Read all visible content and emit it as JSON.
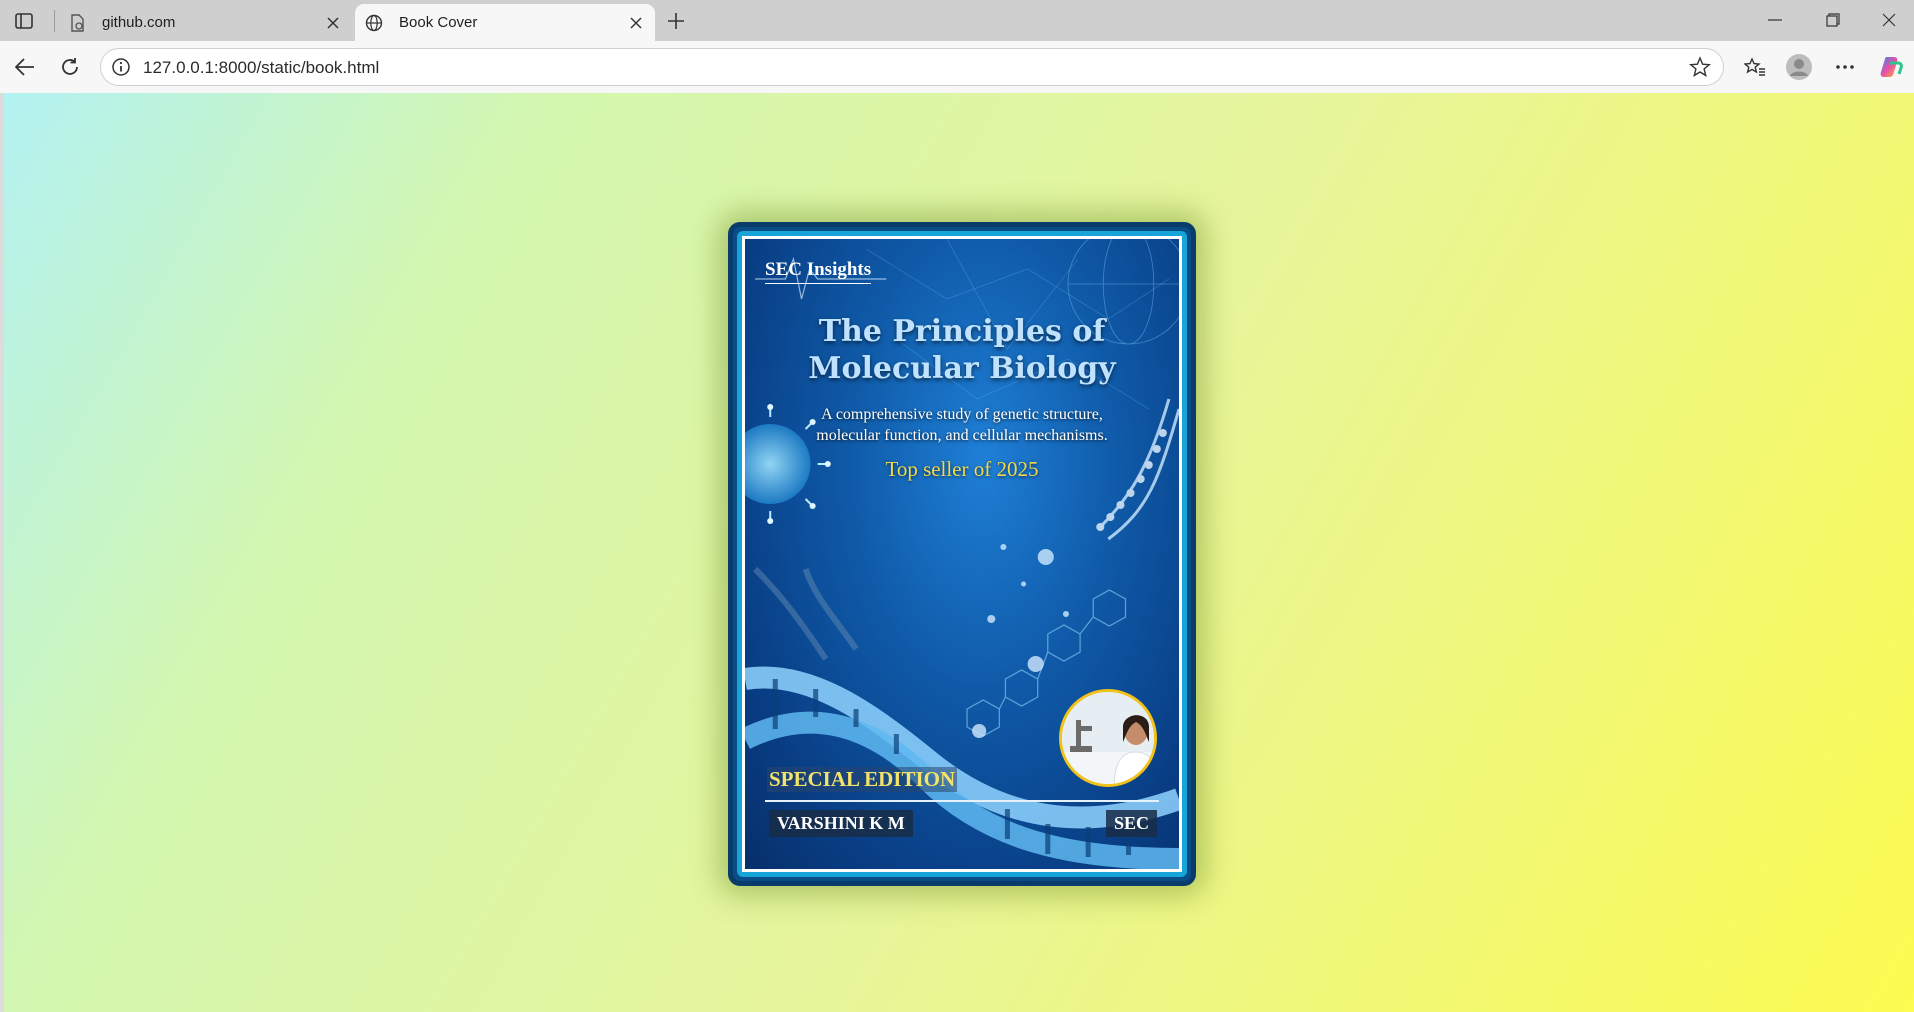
{
  "browser": {
    "tabs": [
      {
        "title": "github.com",
        "icon": "document-icon",
        "active": false
      },
      {
        "title": "Book Cover",
        "icon": "globe-icon",
        "active": true
      }
    ],
    "address": {
      "url": "127.0.0.1:8000/static/book.html"
    }
  },
  "book": {
    "publisher": "SEC Insights",
    "title_line1": "The Principles of",
    "title_line2": "Molecular Biology",
    "subtitle_line1": "A comprehensive study of genetic structure,",
    "subtitle_line2": "molecular function, and cellular mechanisms.",
    "tagline": "Top seller of 2025",
    "edition": "SPECIAL EDITION",
    "author": "VARSHINI K M",
    "imprint": "SEC",
    "colors": {
      "title": "#bfe2ff",
      "tagline": "#f3d84a",
      "edition": "#f3e36b",
      "frame": "#0a4d86",
      "photo_ring": "#f2c21a"
    }
  },
  "page": {
    "background_gradient": [
      "#b3f2f2",
      "#d3f7b0",
      "#e7f59a",
      "#fbfb50"
    ]
  }
}
